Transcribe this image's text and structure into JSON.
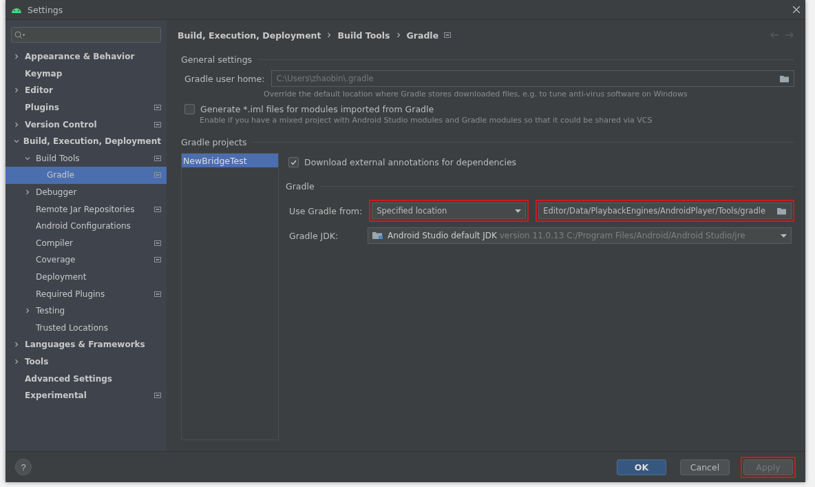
{
  "window": {
    "title": "Settings"
  },
  "sidebar": {
    "items": [
      {
        "label": "Appearance & Behavior",
        "expanded": false,
        "has_children": true,
        "selected": false,
        "project_scoped": false
      },
      {
        "label": "Keymap",
        "has_children": false,
        "selected": false,
        "project_scoped": false
      },
      {
        "label": "Editor",
        "expanded": false,
        "has_children": true,
        "selected": false,
        "project_scoped": false
      },
      {
        "label": "Plugins",
        "has_children": false,
        "selected": false,
        "project_scoped": true
      },
      {
        "label": "Version Control",
        "expanded": false,
        "has_children": true,
        "selected": false,
        "project_scoped": true
      },
      {
        "label": "Build, Execution, Deployment",
        "expanded": true,
        "has_children": true,
        "selected": false,
        "project_scoped": false,
        "children": [
          {
            "label": "Build Tools",
            "expanded": true,
            "has_children": true,
            "selected": false,
            "project_scoped": true,
            "children": [
              {
                "label": "Gradle",
                "has_children": false,
                "selected": true,
                "project_scoped": true
              }
            ]
          },
          {
            "label": "Debugger",
            "expanded": false,
            "has_children": true,
            "selected": false,
            "project_scoped": false
          },
          {
            "label": "Remote Jar Repositories",
            "has_children": false,
            "selected": false,
            "project_scoped": true
          },
          {
            "label": "Android Configurations",
            "has_children": false,
            "selected": false,
            "project_scoped": false
          },
          {
            "label": "Compiler",
            "has_children": false,
            "selected": false,
            "project_scoped": true
          },
          {
            "label": "Coverage",
            "has_children": false,
            "selected": false,
            "project_scoped": true
          },
          {
            "label": "Deployment",
            "has_children": false,
            "selected": false,
            "project_scoped": false
          },
          {
            "label": "Required Plugins",
            "has_children": false,
            "selected": false,
            "project_scoped": true
          },
          {
            "label": "Testing",
            "expanded": false,
            "has_children": true,
            "selected": false,
            "project_scoped": false
          },
          {
            "label": "Trusted Locations",
            "has_children": false,
            "selected": false,
            "project_scoped": false
          }
        ]
      },
      {
        "label": "Languages & Frameworks",
        "expanded": false,
        "has_children": true,
        "selected": false,
        "project_scoped": false
      },
      {
        "label": "Tools",
        "expanded": false,
        "has_children": true,
        "selected": false,
        "project_scoped": false
      },
      {
        "label": "Advanced Settings",
        "has_children": false,
        "selected": false,
        "project_scoped": false
      },
      {
        "label": "Experimental",
        "has_children": false,
        "selected": false,
        "project_scoped": true
      }
    ]
  },
  "breadcrumbs": [
    "Build, Execution, Deployment",
    "Build Tools",
    "Gradle"
  ],
  "general_settings": {
    "title": "General settings",
    "user_home": {
      "label": "Gradle user home:",
      "value": "C:\\Users\\zhaobin\\.gradle",
      "disabled": true,
      "hint": "Override the default location where Gradle stores downloaded files, e.g. to tune anti-virus software on Windows"
    },
    "generate_iml": {
      "label": "Generate *.iml files for modules imported from Gradle",
      "checked": false,
      "hint": "Enable if you have a mixed project with Android Studio modules and Gradle modules so that it could be shared via VCS"
    }
  },
  "gradle_projects": {
    "title": "Gradle projects",
    "projects": [
      {
        "label": "NewBridgeTest",
        "selected": true
      }
    ],
    "download_annotations": {
      "label": "Download external annotations for dependencies",
      "checked": true
    },
    "gradle": {
      "title": "Gradle",
      "use_from": {
        "label": "Use Gradle from:",
        "value": "Specified location",
        "highlighted": true
      },
      "location": {
        "value": "Editor/Data/PlaybackEngines/AndroidPlayer/Tools/gradle",
        "highlighted": true
      },
      "jdk": {
        "label": "Gradle JDK:",
        "value": "Android Studio default JDK",
        "detail": "version 11.0.13 C:/Program Files/Android/Android Studio/jre"
      }
    }
  },
  "help": {
    "label": "?"
  },
  "buttons": [
    {
      "label": "OK",
      "kind": "primary",
      "disabled": false,
      "highlighted": false
    },
    {
      "label": "Cancel",
      "kind": "normal",
      "disabled": false,
      "highlighted": false
    },
    {
      "label": "Apply",
      "kind": "normal",
      "disabled": true,
      "highlighted": true
    }
  ]
}
